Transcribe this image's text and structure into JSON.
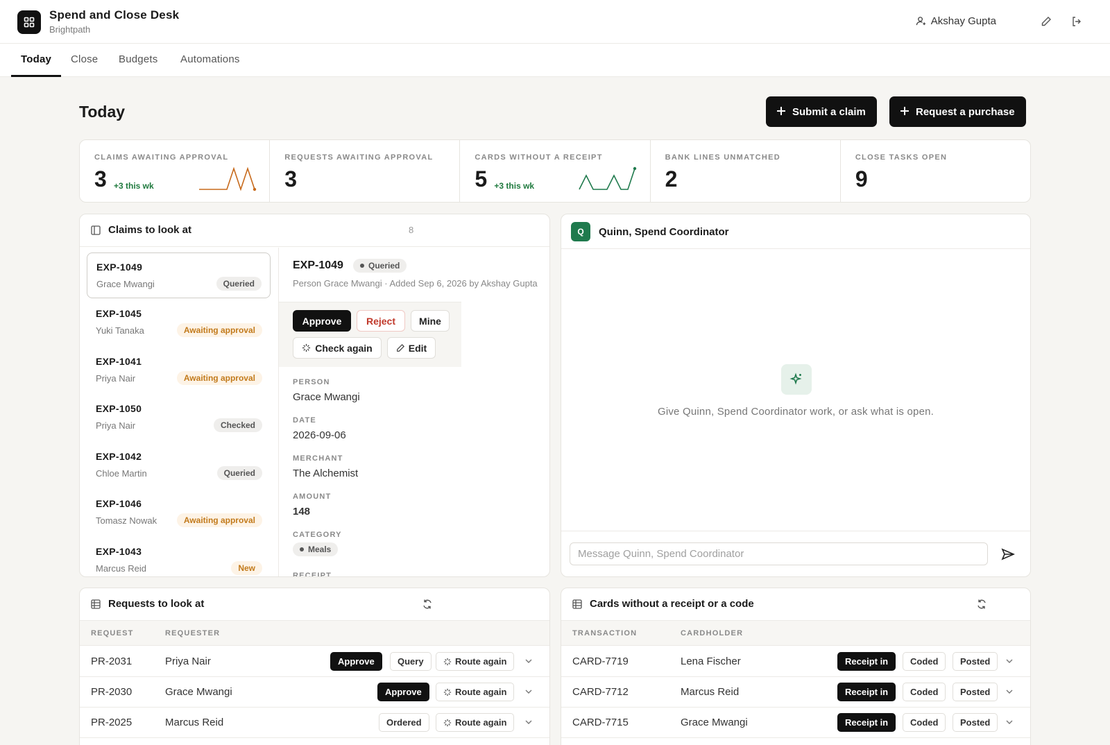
{
  "app": {
    "title": "Spend and Close Desk",
    "org": "Brightpath",
    "user": "Akshay Gupta"
  },
  "tabs": [
    "Today",
    "Close",
    "Budgets",
    "Automations"
  ],
  "page": {
    "title": "Today",
    "submit_claim": "Submit a claim",
    "request_purchase": "Request a purchase"
  },
  "kpis": [
    {
      "label": "CLAIMS AWAITING APPROVAL",
      "value": "3",
      "delta": "+3 this wk",
      "spark": [
        0,
        0,
        0,
        0,
        0,
        3,
        0,
        3,
        0
      ],
      "color": "#c76a1c"
    },
    {
      "label": "REQUESTS AWAITING APPROVAL",
      "value": "3",
      "delta": "",
      "spark": [],
      "color": ""
    },
    {
      "label": "CARDS WITHOUT A RECEIPT",
      "value": "5",
      "delta": "+3 this wk",
      "spark": [
        0,
        2,
        0,
        0,
        0,
        2,
        0,
        0,
        3
      ],
      "color": "#1f7a4d"
    },
    {
      "label": "BANK LINES UNMATCHED",
      "value": "2",
      "delta": "",
      "spark": [],
      "color": ""
    },
    {
      "label": "CLOSE TASKS OPEN",
      "value": "9",
      "delta": "",
      "spark": [],
      "color": ""
    }
  ],
  "claims": {
    "title": "Claims to look at",
    "count": "8",
    "items": [
      {
        "id": "EXP-1049",
        "name": "Grace Mwangi",
        "status": "Queried",
        "kind": "queried"
      },
      {
        "id": "EXP-1045",
        "name": "Yuki Tanaka",
        "status": "Awaiting approval",
        "kind": "awaiting"
      },
      {
        "id": "EXP-1041",
        "name": "Priya Nair",
        "status": "Awaiting approval",
        "kind": "awaiting"
      },
      {
        "id": "EXP-1050",
        "name": "Priya Nair",
        "status": "Checked",
        "kind": "checked"
      },
      {
        "id": "EXP-1042",
        "name": "Chloe Martin",
        "status": "Queried",
        "kind": "queried"
      },
      {
        "id": "EXP-1046",
        "name": "Tomasz Nowak",
        "status": "Awaiting approval",
        "kind": "awaiting"
      },
      {
        "id": "EXP-1043",
        "name": "Marcus Reid",
        "status": "New",
        "kind": "new"
      }
    ],
    "detail": {
      "id": "EXP-1049",
      "status": "Queried",
      "meta": "Person Grace Mwangi · Added Sep 6, 2026 by Akshay Gupta",
      "actions": {
        "approve": "Approve",
        "reject": "Reject",
        "mine": "Mine",
        "check_again": "Check again",
        "edit": "Edit"
      },
      "fields": [
        {
          "label": "PERSON",
          "value": "Grace Mwangi"
        },
        {
          "label": "DATE",
          "value": "2026-09-06"
        },
        {
          "label": "MERCHANT",
          "value": "The Alchemist"
        },
        {
          "label": "AMOUNT",
          "value": "148"
        }
      ],
      "category_label": "CATEGORY",
      "category": "Meals",
      "receipt_label": "RECEIPT"
    }
  },
  "chat": {
    "avatar": "Q",
    "title": "Quinn, Spend Coordinator",
    "empty_text": "Give Quinn, Spend Coordinator work, or ask what is open.",
    "placeholder": "Message Quinn, Spend Coordinator"
  },
  "requests": {
    "title": "Requests to look at",
    "col_request": "REQUEST",
    "col_requester": "REQUESTER",
    "rows": [
      {
        "id": "PR-2031",
        "requester": "Priya Nair",
        "actions": [
          "Approve",
          "Query",
          "Route again"
        ]
      },
      {
        "id": "PR-2030",
        "requester": "Grace Mwangi",
        "actions": [
          "Approve",
          "Route again"
        ]
      },
      {
        "id": "PR-2025",
        "requester": "Marcus Reid",
        "actions": [
          "Ordered",
          "Route again"
        ]
      }
    ]
  },
  "cards": {
    "title": "Cards without a receipt or a code",
    "col_txn": "TRANSACTION",
    "col_holder": "CARDHOLDER",
    "rows": [
      {
        "id": "CARD-7719",
        "holder": "Lena Fischer",
        "actions": [
          "Receipt in",
          "Coded",
          "Posted"
        ]
      },
      {
        "id": "CARD-7712",
        "holder": "Marcus Reid",
        "actions": [
          "Receipt in",
          "Coded",
          "Posted"
        ]
      },
      {
        "id": "CARD-7715",
        "holder": "Grace Mwangi",
        "actions": [
          "Receipt in",
          "Coded",
          "Posted"
        ]
      }
    ]
  }
}
